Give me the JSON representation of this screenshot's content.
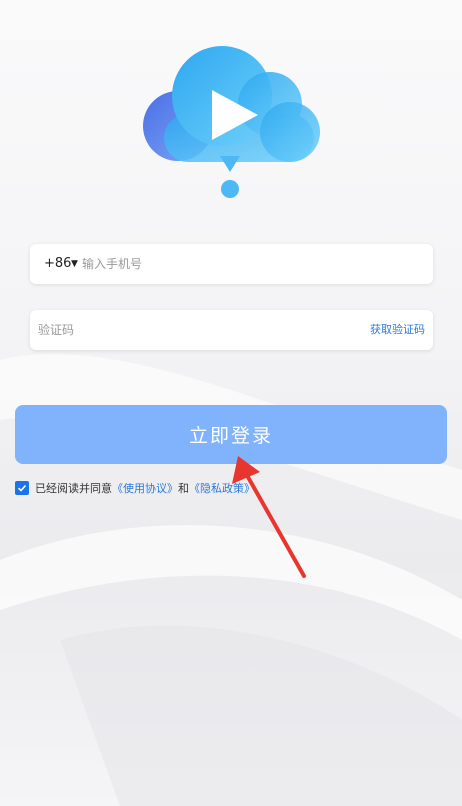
{
  "colors": {
    "primary": "#80b3fb",
    "link": "#2a7ad8",
    "checkbox": "#1a73e8",
    "arrow": "#e8352e"
  },
  "logo": {
    "icon": "cloud-play-icon"
  },
  "phone": {
    "country_code": "+86",
    "placeholder": "输入手机号"
  },
  "code": {
    "placeholder": "验证码",
    "get_code_label": "获取验证码"
  },
  "login": {
    "label": "立即登录"
  },
  "agreement": {
    "checked": true,
    "prefix": "已经阅读并同意",
    "terms_link": "《使用协议》",
    "conjunction": "和",
    "privacy_link": "《隐私政策》"
  }
}
